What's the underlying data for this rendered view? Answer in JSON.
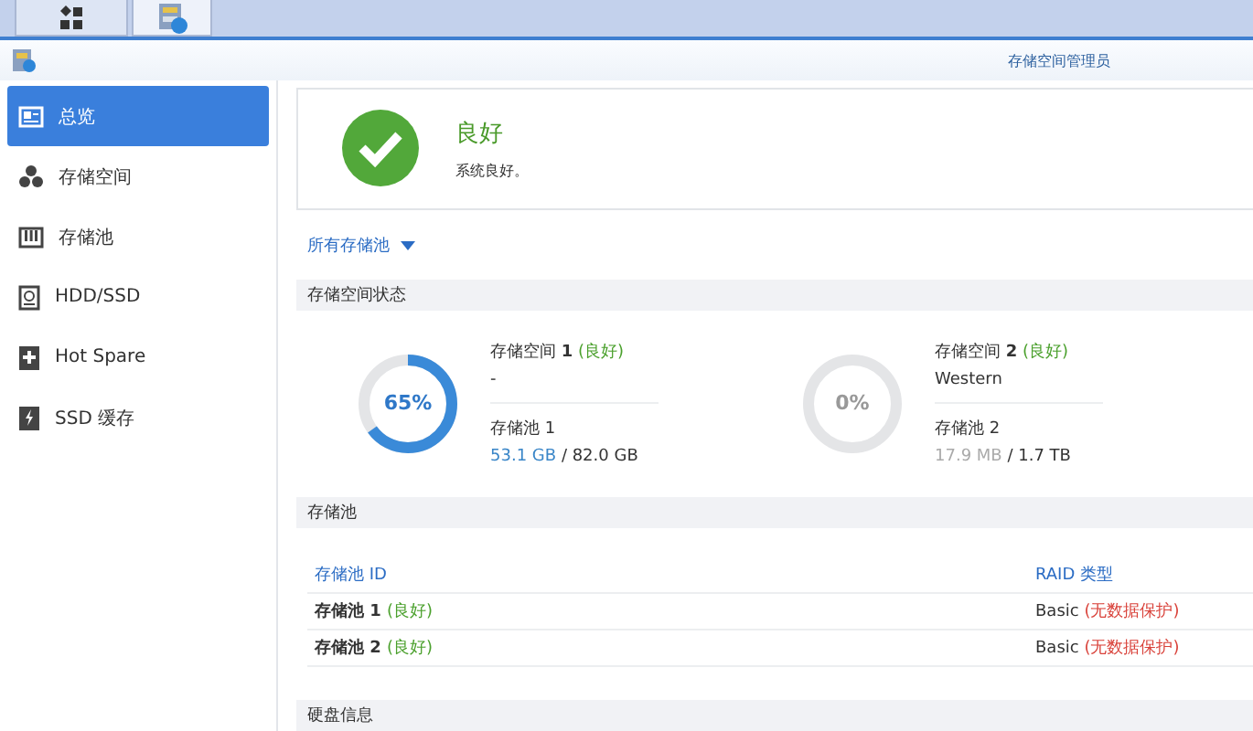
{
  "taskbar": {
    "tabs": [
      {
        "kind": "apps",
        "selected": false
      },
      {
        "kind": "storage",
        "selected": true
      }
    ]
  },
  "window": {
    "title": "存储空间管理员"
  },
  "sidebar": {
    "items": [
      {
        "kind": "overview",
        "label": "总览",
        "selected": true
      },
      {
        "kind": "volume",
        "label": "存储空间",
        "selected": false
      },
      {
        "kind": "pool",
        "label": "存储池",
        "selected": false
      },
      {
        "kind": "disk",
        "label": "HDD/SSD",
        "selected": false
      },
      {
        "kind": "spare",
        "label": "Hot Spare",
        "selected": false
      },
      {
        "kind": "cache",
        "label": "SSD 缓存",
        "selected": false
      }
    ]
  },
  "health": {
    "status": "良好",
    "message": "系统良好。"
  },
  "filter": {
    "label": "所有存储池"
  },
  "volume_section": {
    "title": "存储空间状态",
    "volumes": [
      {
        "name": "存储空间 **1**",
        "status": "(良好)",
        "description": "-",
        "pool": "存储池 1",
        "used": "53.1 GB",
        "total": "/ 82.0 GB",
        "percent": "65%",
        "level": 0.65
      },
      {
        "name": "存储空间 **2**",
        "status": "(良好)",
        "description": "Western",
        "pool": "存储池 2",
        "used": "17.9 MB",
        "total": "/ 1.7 TB",
        "percent": "0%",
        "level": 0
      }
    ]
  },
  "pool_section": {
    "title": "存储池",
    "columns": [
      "存储池 ID",
      "RAID 类型"
    ],
    "rows": [
      {
        "name": "存储池 1",
        "status": "(良好)",
        "raid": "Basic",
        "protection": "(无数据保护)"
      },
      {
        "name": "存储池 2",
        "status": "(良好)",
        "raid": "Basic",
        "protection": "(无数据保护)"
      }
    ]
  },
  "disk_section": {
    "title": "硬盘信息"
  }
}
